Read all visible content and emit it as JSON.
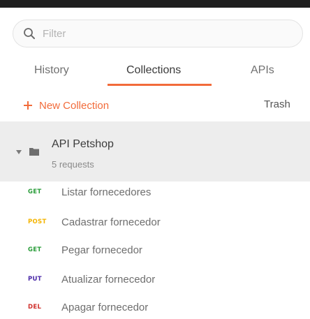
{
  "search": {
    "placeholder": "Filter",
    "value": ""
  },
  "tabs": [
    {
      "label": "History",
      "active": false
    },
    {
      "label": "Collections",
      "active": true
    },
    {
      "label": "APIs",
      "active": false
    }
  ],
  "actions": {
    "new_collection": "New Collection",
    "trash": "Trash"
  },
  "collection": {
    "name": "API Petshop",
    "count": "5 requests"
  },
  "requests": [
    {
      "method": "GET",
      "name": "Listar fornecedores",
      "color": "#2a9d3a"
    },
    {
      "method": "POST",
      "name": "Cadastrar fornecedor",
      "color": "#f4b400"
    },
    {
      "method": "GET",
      "name": "Pegar fornecedor",
      "color": "#2a9d3a"
    },
    {
      "method": "PUT",
      "name": "Atualizar fornecedor",
      "color": "#4b2aa8"
    },
    {
      "method": "DEL",
      "name": "Apagar fornecedor",
      "color": "#d0312d"
    }
  ],
  "colors": {
    "accent": "#f26b3a",
    "collection_bg": "#ededed"
  },
  "icons": [
    "search-icon",
    "plus-icon",
    "caret-down-icon",
    "folder-icon"
  ]
}
